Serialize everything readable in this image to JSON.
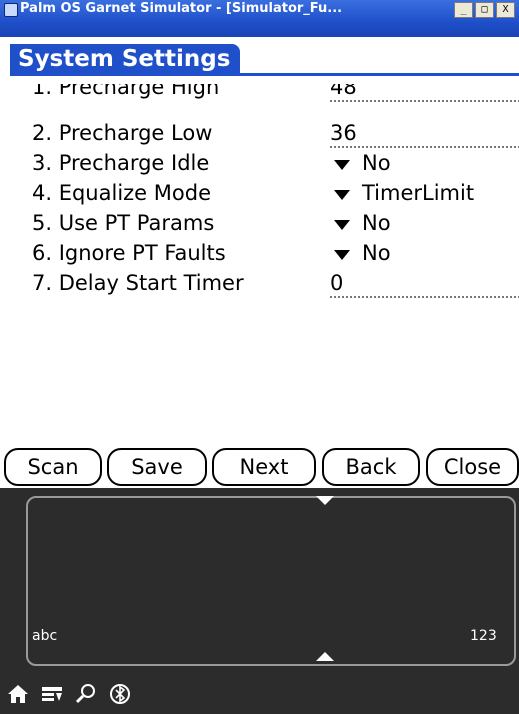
{
  "window": {
    "title": "Palm OS Garnet Simulator - [Simulator_Fu...",
    "buttons": [
      "_",
      "□",
      "X"
    ]
  },
  "form": {
    "title": "System Settings"
  },
  "list": {
    "rows": [
      {
        "label": "1. Precharge High",
        "value": "48",
        "type": "text"
      },
      {
        "label": "2. Precharge Low",
        "value": "36",
        "type": "text"
      },
      {
        "label": "3. Precharge Idle",
        "value": "No",
        "type": "popup"
      },
      {
        "label": "4. Equalize Mode",
        "value": "TimerLimit",
        "type": "popup"
      },
      {
        "label": "5. Use PT Params",
        "value": "No",
        "type": "popup"
      },
      {
        "label": "6. Ignore PT Faults",
        "value": "No",
        "type": "popup"
      },
      {
        "label": "7. Delay Start Timer",
        "value": "0",
        "type": "text"
      }
    ]
  },
  "buttons": {
    "scan": "Scan",
    "save": "Save",
    "next": "Next",
    "back": "Back",
    "close": "Close"
  },
  "graffiti": {
    "alpha_label": "abc",
    "numeric_label": "123",
    "icons": [
      "home-icon",
      "menu-icon",
      "find-icon",
      "bluetooth-icon"
    ]
  },
  "colors": {
    "title_blue": "#1f4fc9",
    "graffiti_bg": "#2c2c2c"
  }
}
